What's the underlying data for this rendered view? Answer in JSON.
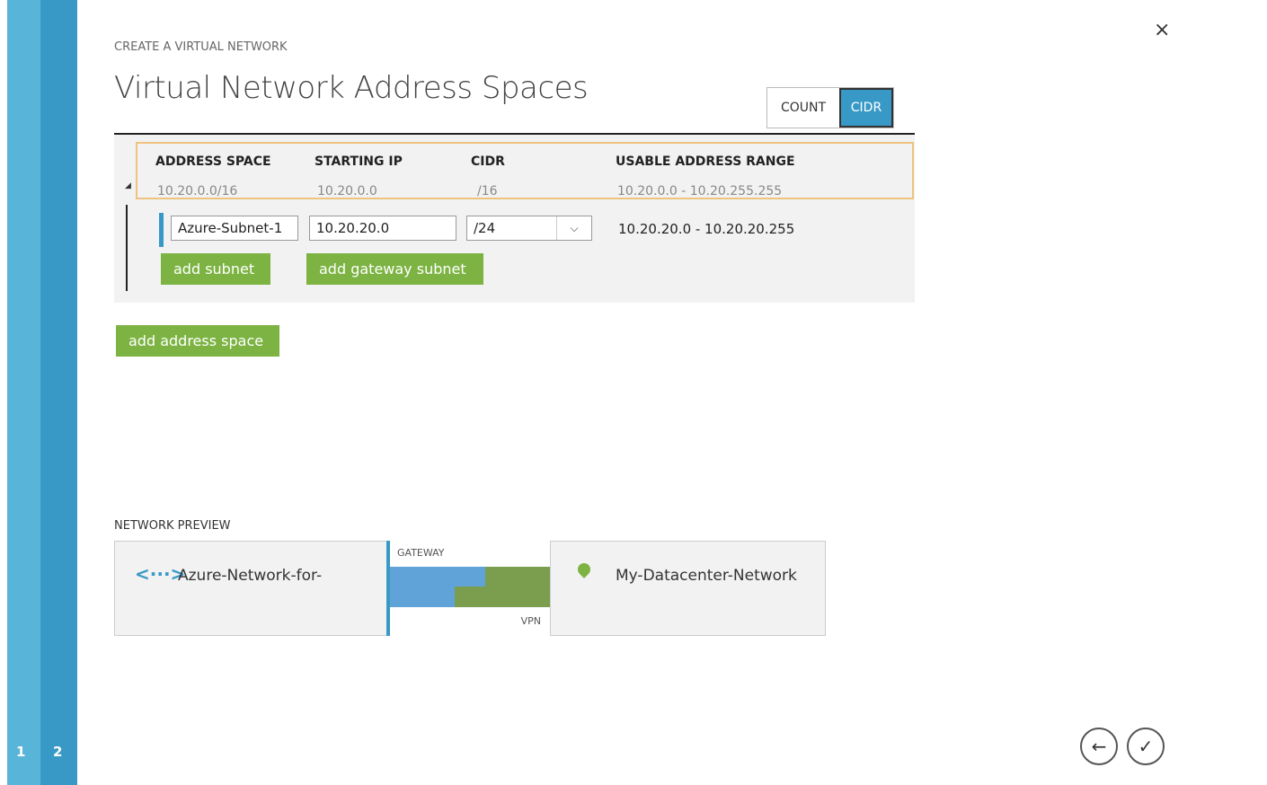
{
  "wizard": {
    "steps": [
      "1",
      "2"
    ],
    "close": "×"
  },
  "header": {
    "subtitle": "CREATE A VIRTUAL NETWORK",
    "title": "Virtual Network Address Spaces"
  },
  "toggle": {
    "count_label": "COUNT",
    "cidr_label": "CIDR",
    "selected": "CIDR"
  },
  "table": {
    "headers": [
      "ADDRESS SPACE",
      "STARTING IP",
      "CIDR",
      "USABLE ADDRESS RANGE"
    ],
    "address_space": {
      "space": "10.20.0.0/16",
      "starting_ip": "10.20.0.0",
      "cidr": "/16",
      "range": "10.20.0.0 - 10.20.255.255"
    },
    "subnet": {
      "name": "Azure-Subnet-1",
      "starting_ip": "10.20.20.0",
      "cidr": "/24",
      "range": "10.20.20.0 - 10.20.20.255"
    },
    "add_subnet_label": "add subnet",
    "add_gateway_subnet_label": "add gateway subnet"
  },
  "add_address_space_label": "add address space",
  "preview": {
    "label": "NETWORK PREVIEW",
    "azure_network": "Azure-Network-for-",
    "azure_icon": "<···>",
    "gateway_label": "GATEWAY",
    "vpn_label": "VPN",
    "local_network": "My-Datacenter-Network"
  },
  "nav": {
    "back": "←",
    "finish": "✓"
  },
  "colors": {
    "blue": "#3999c6",
    "green": "#7cb342",
    "highlight": "#f0c280"
  }
}
